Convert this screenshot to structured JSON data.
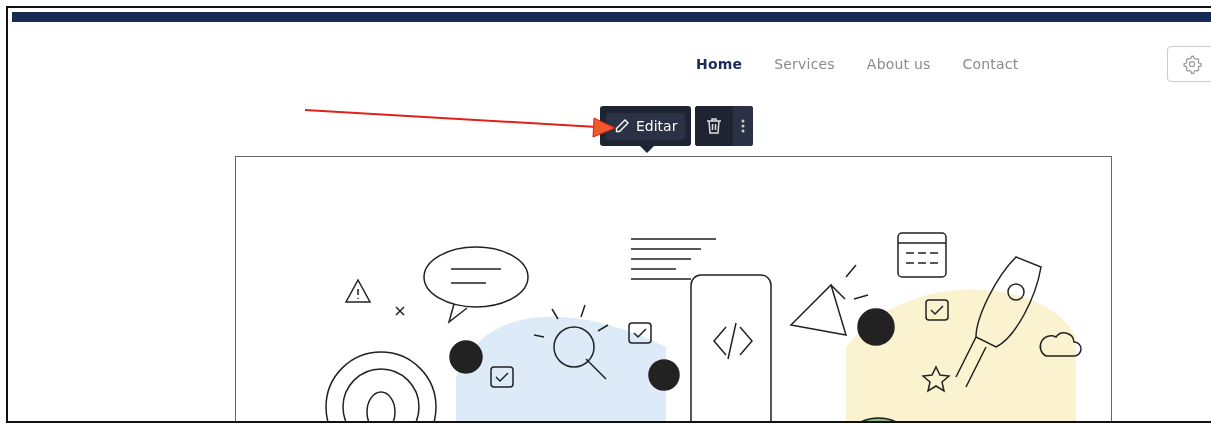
{
  "nav": {
    "items": [
      {
        "label": "Home",
        "selected": true
      },
      {
        "label": "Services",
        "selected": false
      },
      {
        "label": "About us",
        "selected": false
      },
      {
        "label": "Contact",
        "selected": false
      }
    ]
  },
  "block_toolbar": {
    "edit_label": "Editar"
  }
}
